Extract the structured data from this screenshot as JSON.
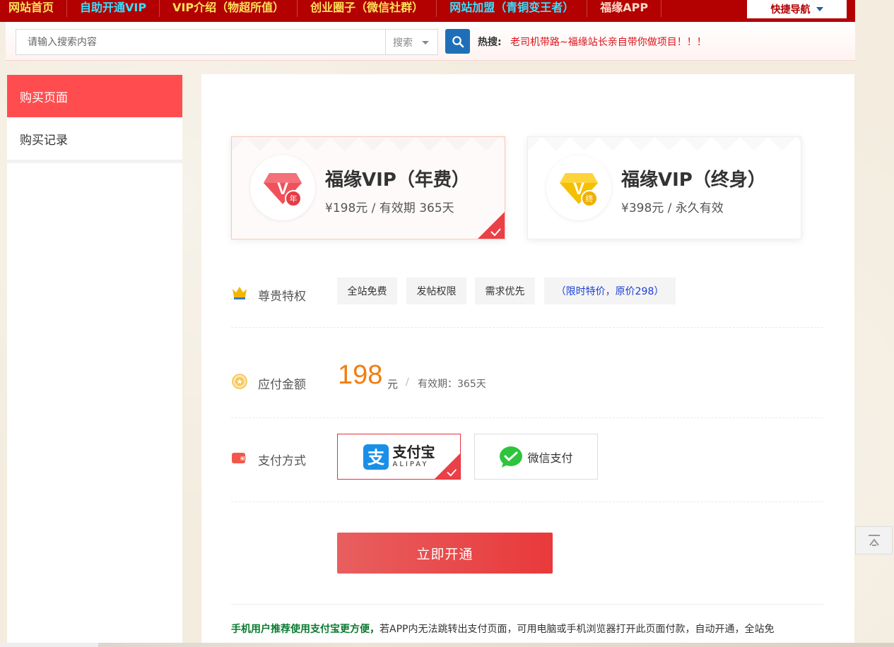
{
  "topnav": {
    "items": [
      {
        "label": "网站首页",
        "color": "#ffe15a"
      },
      {
        "label": "自助开通VIP",
        "color": "#36e0ff"
      },
      {
        "label": "VIP介绍（物超所值）",
        "color": "#ffe15a"
      },
      {
        "label": "创业圈子（微信社群）",
        "color": "#ffe15a"
      },
      {
        "label": "网站加盟（青铜变王者）",
        "color": "#36e0ff"
      },
      {
        "label": "福缘APP",
        "color": "#ffd8c8"
      }
    ],
    "quick_nav_label": "快捷导航",
    "bg_color": "#b30000"
  },
  "search": {
    "placeholder": "请输入搜索内容",
    "value": "",
    "select_value": "搜索",
    "button_icon": "search-icon",
    "hot_label": "热搜:",
    "hot_link": "老司机带路~福缘站长亲自带你做项目！！！"
  },
  "sidebar": {
    "items": [
      {
        "label": "购买页面",
        "active": true
      },
      {
        "label": "购买记录",
        "active": false
      }
    ],
    "accent_color": "#ff4d4f"
  },
  "plans": [
    {
      "title": "福缘VIP（年费）",
      "subtitle": "¥198元 / 有效期 365天",
      "badge_char": "年",
      "selected": true,
      "color": "#f0525a"
    },
    {
      "title": "福缘VIP（终身）",
      "subtitle": "¥398元 / 永久有效",
      "badge_char": "终",
      "selected": false,
      "color": "#f5c000"
    }
  ],
  "privileges": {
    "label": "尊贵特权",
    "icon": "crown-icon",
    "tags": [
      "全站免费",
      "发帖权限",
      "需求优先"
    ],
    "promo": "（限时特价，原价298）"
  },
  "amount": {
    "label": "应付金额",
    "icon": "medal-icon",
    "value": "198",
    "unit": "元",
    "separator": "/",
    "period": "有效期：365天",
    "color": "#f27d0c"
  },
  "payment": {
    "label": "支付方式",
    "icon": "wallet-icon",
    "methods": [
      {
        "name": "支付宝",
        "sub": "ALIPAY",
        "selected": true
      },
      {
        "name": "微信支付",
        "selected": false
      }
    ]
  },
  "submit_label": "立即开通",
  "notice": {
    "highlight": "手机用户推荐使用支付宝更方便，",
    "text": "若APP内无法跳转出支付页面，可用电脑或手机浏览器打开此页面付款，自动开通，全站免"
  }
}
